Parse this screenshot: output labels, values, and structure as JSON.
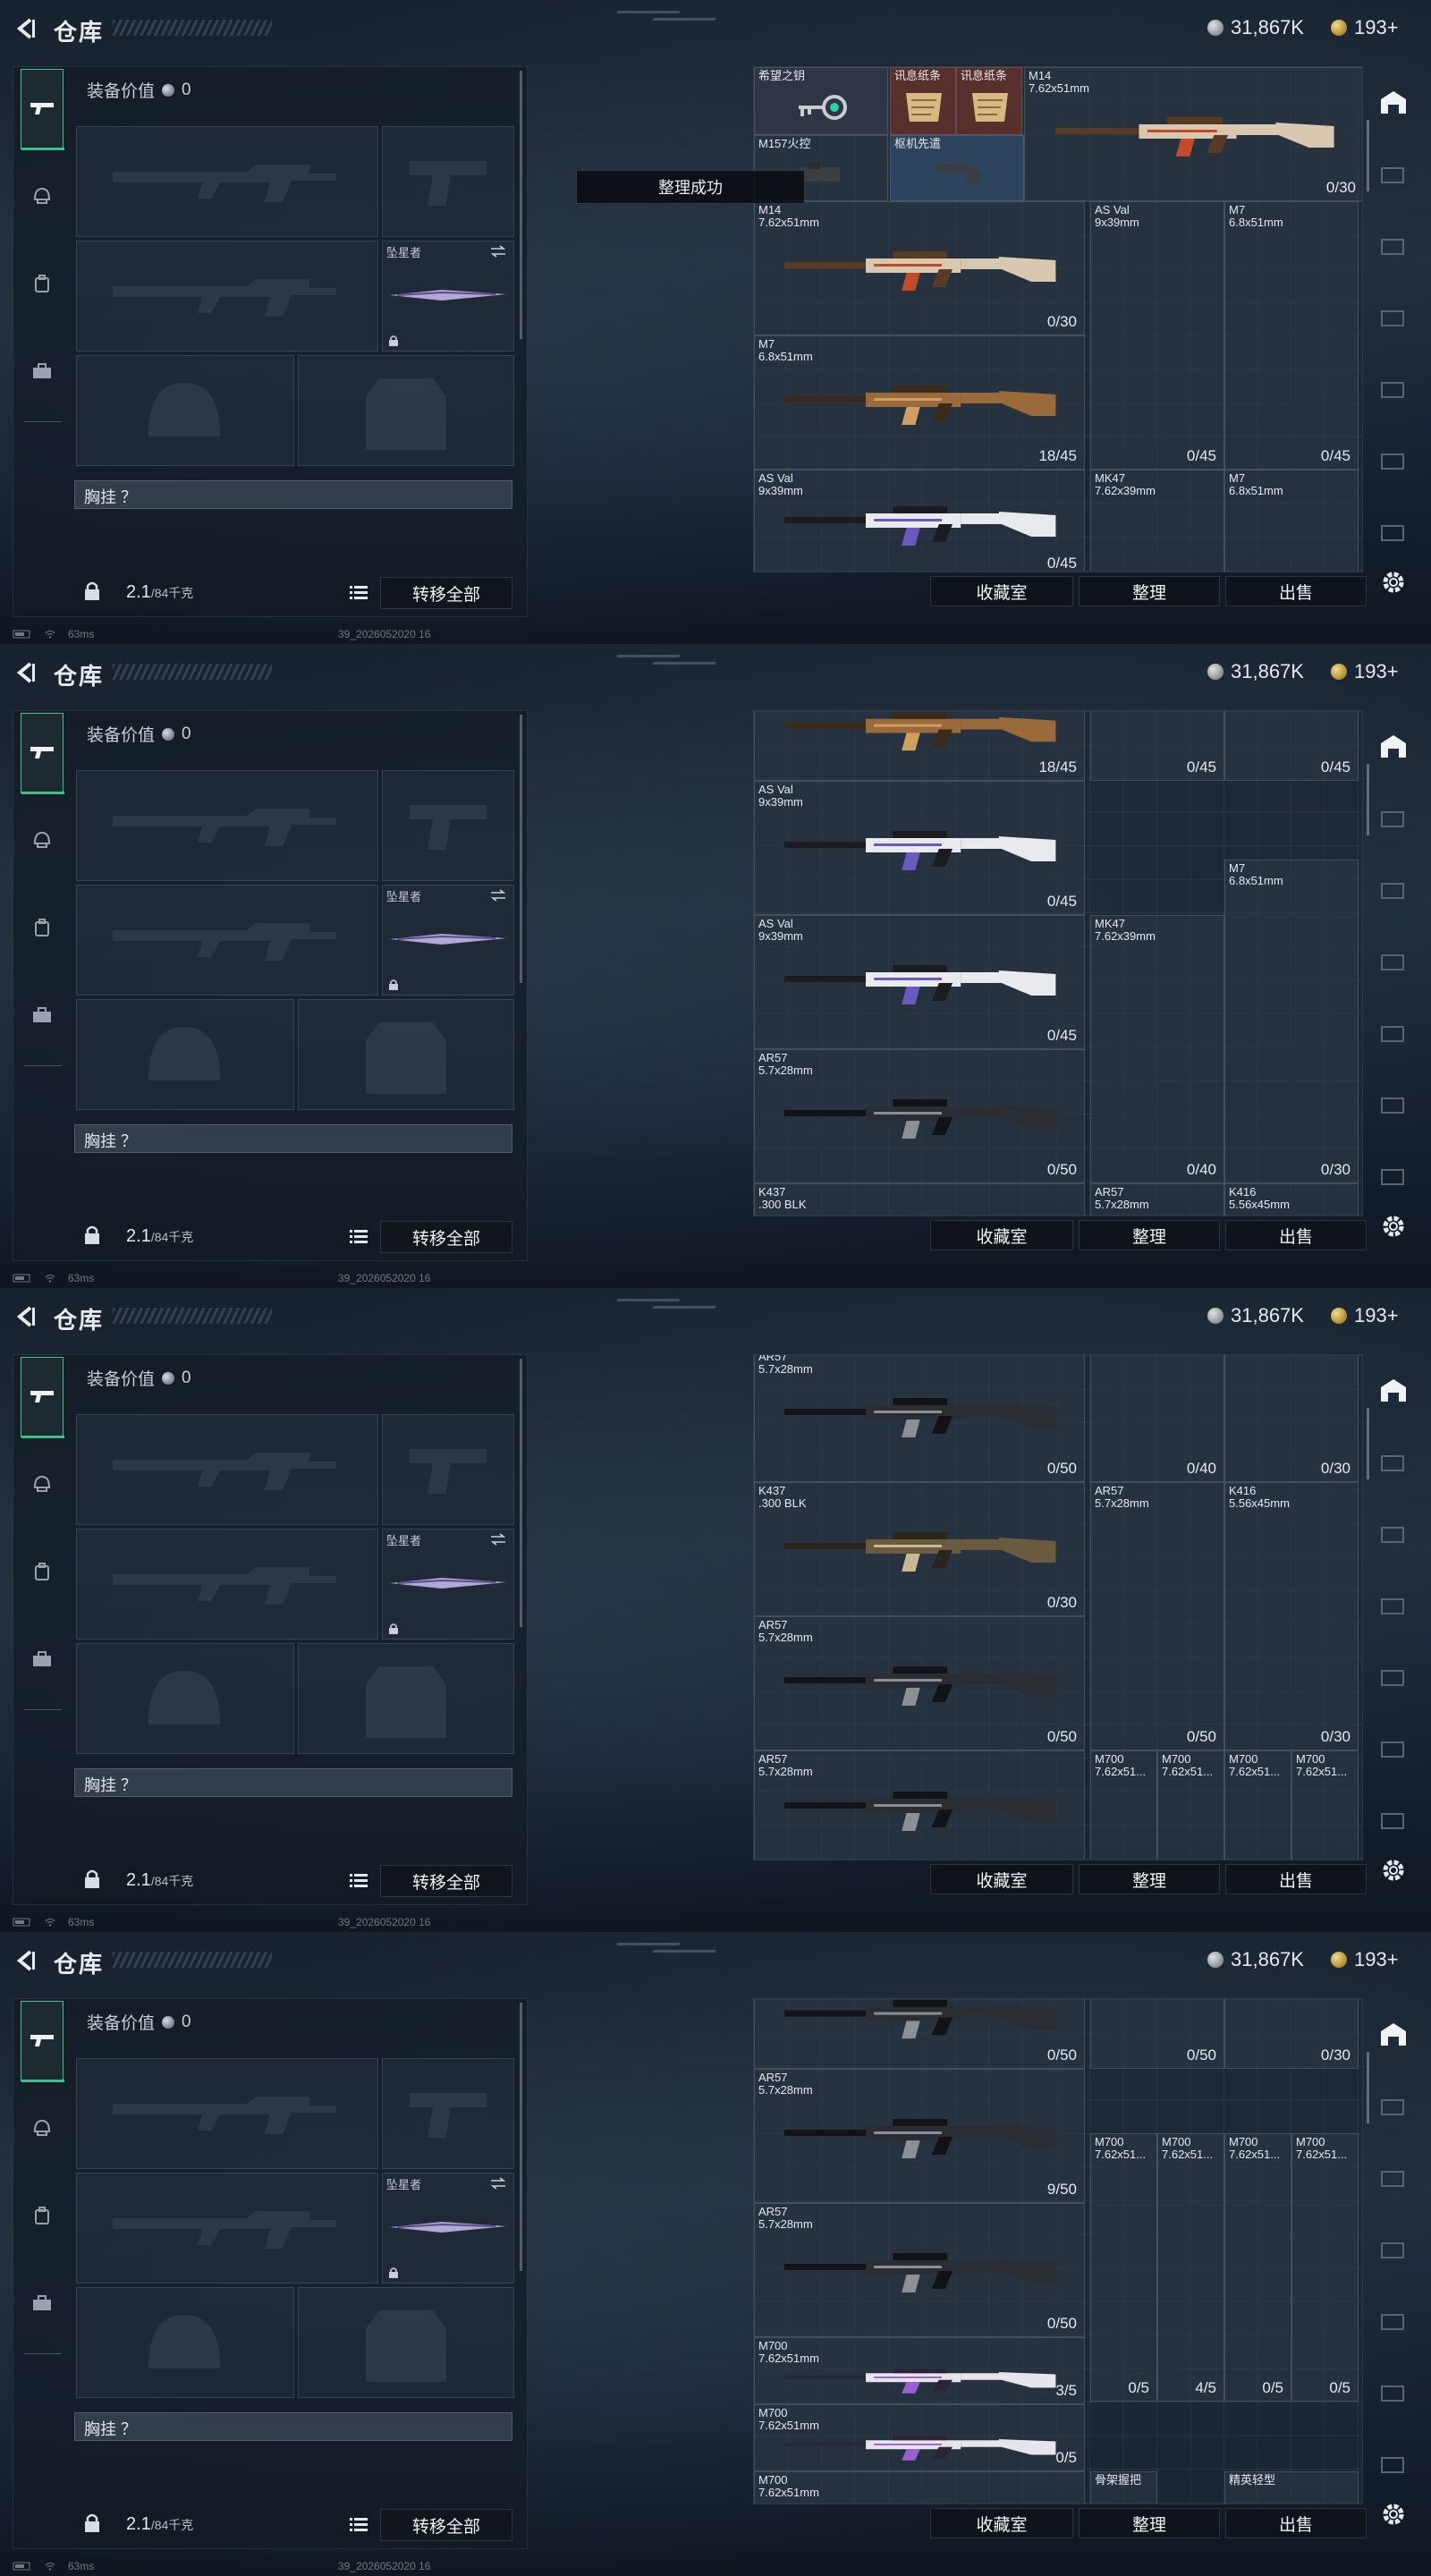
{
  "header": {
    "title": "仓库",
    "silver_amount": "31,867K",
    "gold_amount": "193+"
  },
  "left": {
    "equip_value_label": "装备价值",
    "equip_value": "0",
    "melee_label": "坠星者",
    "chest_label": "胸挂 ？",
    "weight_value": "2.1",
    "weight_capacity": "/84千克",
    "transfer_all": "转移全部"
  },
  "actions": {
    "collection": "收藏室",
    "sort": "整理",
    "sell": "出售"
  },
  "toast": "整理成功",
  "status": {
    "ping": "63ms",
    "uid": "39_2026052020 16"
  },
  "icons": {
    "back": "back-arrow-icon",
    "tabs": [
      "gun-icon",
      "helmet-icon",
      "backpack-icon",
      "briefcase-icon"
    ],
    "side": [
      "home-icon",
      "crate-icon",
      "settings-icon"
    ]
  },
  "frames": [
    {
      "show_toast": true,
      "cards": [
        {
          "name": "希望之钥",
          "count": "",
          "kind": "key"
        },
        {
          "name": "讯息纸条",
          "count": "",
          "kind": "note"
        },
        {
          "name": "讯息纸条",
          "count": "",
          "kind": "note"
        },
        {
          "name": "M14\n7.62x51mm",
          "count": "0/30",
          "kind": "rifle-gold"
        },
        {
          "name": "M157火控",
          "count": "",
          "kind": "scope"
        },
        {
          "name": "枢机先遣",
          "count": "",
          "kind": "stock"
        },
        {
          "name": "M14\n7.62x51mm",
          "count": "0/30",
          "kind": "rifle-gold"
        },
        {
          "name": "AS Val\n9x39mm",
          "count": "0/45",
          "kind": "vert-white"
        },
        {
          "name": "M7\n6.8x51mm",
          "count": "0/45",
          "kind": "vert-bronze"
        },
        {
          "name": "M7\n6.8x51mm",
          "count": "18/45",
          "kind": "rifle-bronze"
        },
        {
          "name": "AS Val\n9x39mm",
          "count": "0/45",
          "kind": "rifle-white"
        },
        {
          "name": "MK47\n7.62x39mm",
          "count": "",
          "kind": "none"
        },
        {
          "name": "M7\n6.8x51mm",
          "count": "",
          "kind": "none"
        }
      ]
    },
    {
      "show_toast": false,
      "cards": [
        {
          "name": "",
          "count": "18/45",
          "kind": "rifle-bronze"
        },
        {
          "name": "",
          "count": "0/45",
          "kind": "vert-white"
        },
        {
          "name": "",
          "count": "0/45",
          "kind": "vert-bronze"
        },
        {
          "name": "AS Val\n9x39mm",
          "count": "0/45",
          "kind": "rifle-white"
        },
        {
          "name": "MK47\n7.62x39mm",
          "count": "0/40",
          "kind": "vert-pink"
        },
        {
          "name": "M7\n6.8x51mm",
          "count": "0/30",
          "kind": "vert-bronze"
        },
        {
          "name": "AS Val\n9x39mm",
          "count": "0/45",
          "kind": "rifle-white"
        },
        {
          "name": "AR57\n5.7x28mm",
          "count": "0/50",
          "kind": "rifle-black"
        },
        {
          "name": "K437\n.300 BLK",
          "count": "",
          "kind": "none"
        },
        {
          "name": "AR57\n5.7x28mm",
          "count": "",
          "kind": "none"
        },
        {
          "name": "K416\n5.56x45mm",
          "count": "",
          "kind": "none"
        }
      ]
    },
    {
      "show_toast": false,
      "cards": [
        {
          "name": "AR57\n5.7x28mm",
          "count": "0/50",
          "kind": "rifle-black"
        },
        {
          "name": "",
          "count": "0/40",
          "kind": "vert-pink"
        },
        {
          "name": "",
          "count": "0/30",
          "kind": "vert-bronze"
        },
        {
          "name": "K437\n.300 BLK",
          "count": "0/30",
          "kind": "rifle-camo"
        },
        {
          "name": "AR57\n5.7x28mm",
          "count": "0/50",
          "kind": "vert-black"
        },
        {
          "name": "K416\n5.56x45mm",
          "count": "0/30",
          "kind": "vert-purple"
        },
        {
          "name": "AR57\n5.7x28mm",
          "count": "0/50",
          "kind": "rifle-black"
        },
        {
          "name": "AR57\n5.7x28mm",
          "count": "",
          "kind": "rifle-black"
        },
        {
          "name": "M700\n7.62x51...",
          "count": "",
          "kind": "none"
        },
        {
          "name": "M700\n7.62x51...",
          "count": "",
          "kind": "none"
        },
        {
          "name": "M700\n7.62x51...",
          "count": "",
          "kind": "none"
        },
        {
          "name": "M700\n7.62x51...",
          "count": "",
          "kind": "none"
        }
      ]
    },
    {
      "show_toast": false,
      "cards": [
        {
          "name": "",
          "count": "0/50",
          "kind": "rifle-black"
        },
        {
          "name": "",
          "count": "0/50",
          "kind": "vert-black"
        },
        {
          "name": "",
          "count": "0/30",
          "kind": "vert-purple"
        },
        {
          "name": "AR57\n5.7x28mm",
          "count": "9/50",
          "kind": "rifle-black"
        },
        {
          "name": "M700\n7.62x51...",
          "count": "0/5",
          "kind": "vert-sniper"
        },
        {
          "name": "M700\n7.62x51...",
          "count": "4/5",
          "kind": "vert-sniper"
        },
        {
          "name": "M700\n7.62x51...",
          "count": "0/5",
          "kind": "vert-sniper"
        },
        {
          "name": "M700\n7.62x51...",
          "count": "0/5",
          "kind": "vert-sniper"
        },
        {
          "name": "AR57\n5.7x28mm",
          "count": "0/50",
          "kind": "rifle-black"
        },
        {
          "name": "M700\n7.62x51mm",
          "count": "3/5",
          "kind": "rifle-sniper"
        },
        {
          "name": "M700\n7.62x51mm",
          "count": "0/5",
          "kind": "rifle-sniper"
        },
        {
          "name": "M700\n7.62x51mm",
          "count": "",
          "kind": "none"
        },
        {
          "name": "骨架握把",
          "count": "",
          "kind": "none"
        },
        {
          "name": "精英轻型",
          "count": "",
          "kind": "none"
        }
      ]
    }
  ]
}
